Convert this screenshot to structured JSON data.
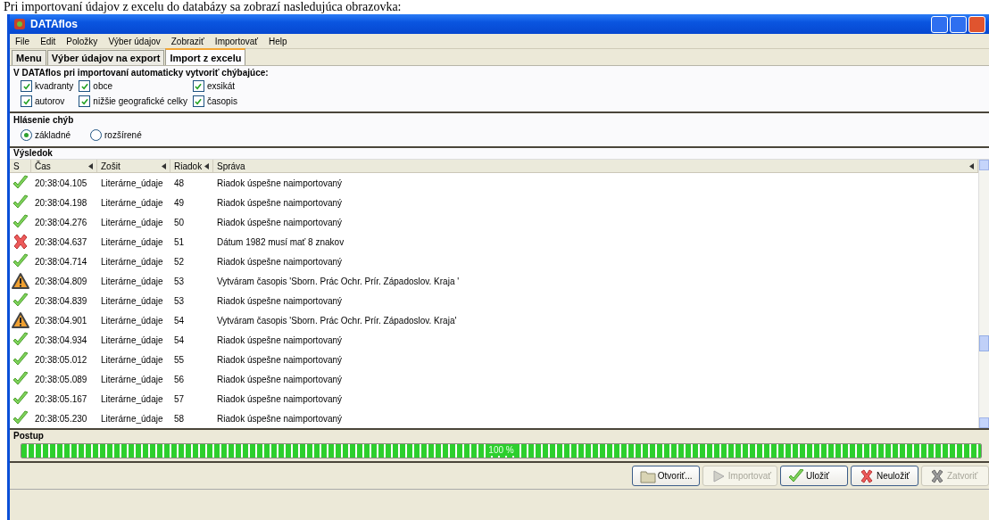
{
  "caption": "Pri importovaní údajov z excelu do databázy sa zobrazí nasledujúca obrazovka:",
  "window": {
    "title": "DATAflos"
  },
  "menu": [
    "File",
    "Edit",
    "Položky",
    "Výber údajov",
    "Zobraziť",
    "Importovať",
    "Help"
  ],
  "tabs": [
    {
      "label": "Menu",
      "selected": false
    },
    {
      "label": "Výber údajov na export",
      "selected": false
    },
    {
      "label": "Import z excelu",
      "selected": true
    }
  ],
  "auto_create": {
    "title": "V DATAflos pri importovaní automaticky vytvoriť chýbajúce:",
    "options": [
      {
        "label": "kvadranty",
        "checked": true
      },
      {
        "label": "obce",
        "checked": true
      },
      {
        "label": "exsikát",
        "checked": true
      },
      {
        "label": "autorov",
        "checked": true
      },
      {
        "label": "nižšie geografické celky",
        "checked": true
      },
      {
        "label": "časopis",
        "checked": true
      }
    ]
  },
  "error_report": {
    "title": "Hlásenie chýb",
    "options": [
      {
        "label": "základné",
        "selected": true
      },
      {
        "label": "rozšírené",
        "selected": false
      }
    ]
  },
  "results": {
    "title": "Výsledok",
    "columns": [
      "S",
      "Čas",
      "Zošit",
      "Riadok",
      "Správa"
    ],
    "rows": [
      {
        "kind": "ok",
        "time": "20:38:04.105",
        "sheet": "Literárne_údaje",
        "row": "48",
        "message": "Riadok úspešne naimportovaný"
      },
      {
        "kind": "ok",
        "time": "20:38:04.198",
        "sheet": "Literárne_údaje",
        "row": "49",
        "message": "Riadok úspešne naimportovaný"
      },
      {
        "kind": "ok",
        "time": "20:38:04.276",
        "sheet": "Literárne_údaje",
        "row": "50",
        "message": "Riadok úspešne naimportovaný"
      },
      {
        "kind": "error",
        "time": "20:38:04.637",
        "sheet": "Literárne_údaje",
        "row": "51",
        "message": "Dátum 1982 musí mať 8 znakov"
      },
      {
        "kind": "ok",
        "time": "20:38:04.714",
        "sheet": "Literárne_údaje",
        "row": "52",
        "message": "Riadok úspešne naimportovaný"
      },
      {
        "kind": "warning",
        "time": "20:38:04.809",
        "sheet": "Literárne_údaje",
        "row": "53",
        "message": "Vytváram časopis 'Sborn. Prác Ochr. Prír. Západoslov. Kraja '"
      },
      {
        "kind": "ok",
        "time": "20:38:04.839",
        "sheet": "Literárne_údaje",
        "row": "53",
        "message": "Riadok úspešne naimportovaný"
      },
      {
        "kind": "warning",
        "time": "20:38:04.901",
        "sheet": "Literárne_údaje",
        "row": "54",
        "message": "Vytváram časopis 'Sborn. Prác Ochr. Prír. Západoslov. Kraja'"
      },
      {
        "kind": "ok",
        "time": "20:38:04.934",
        "sheet": "Literárne_údaje",
        "row": "54",
        "message": "Riadok úspešne naimportovaný"
      },
      {
        "kind": "ok",
        "time": "20:38:05.012",
        "sheet": "Literárne_údaje",
        "row": "55",
        "message": "Riadok úspešne naimportovaný"
      },
      {
        "kind": "ok",
        "time": "20:38:05.089",
        "sheet": "Literárne_údaje",
        "row": "56",
        "message": "Riadok úspešne naimportovaný"
      },
      {
        "kind": "ok",
        "time": "20:38:05.167",
        "sheet": "Literárne_údaje",
        "row": "57",
        "message": "Riadok úspešne naimportovaný"
      },
      {
        "kind": "ok",
        "time": "20:38:05.230",
        "sheet": "Literárne_údaje",
        "row": "58",
        "message": "Riadok úspešne naimportovaný"
      }
    ]
  },
  "progress": {
    "title": "Postup",
    "level": 1,
    "reading": "100 %"
  },
  "buttons": [
    {
      "kind": "open",
      "label": "Otvoriť...",
      "disabled": false
    },
    {
      "kind": "play",
      "label": "Importovať",
      "disabled": true
    },
    {
      "kind": "check",
      "label": "Uložiť",
      "disabled": false
    },
    {
      "kind": "cross",
      "label": "Neuložiť",
      "disabled": false
    },
    {
      "kind": "greycross",
      "label": "Zatvoriť",
      "disabled": true
    }
  ]
}
